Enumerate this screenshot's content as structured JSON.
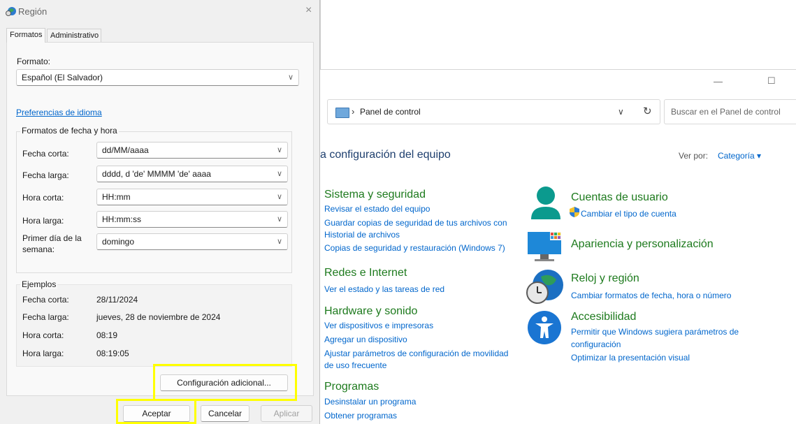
{
  "dialog": {
    "title": "Región",
    "close_glyph": "×",
    "tabs": [
      {
        "label": "Formatos"
      },
      {
        "label": "Administrativo"
      }
    ],
    "format_label": "Formato:",
    "format_value": "Español (El Salvador)",
    "lang_prefs_link": "Preferencias de idioma",
    "date_time_group": {
      "title": "Formatos de fecha y hora",
      "rows": [
        {
          "label": "Fecha corta:",
          "value": "dd/MM/aaaa"
        },
        {
          "label": "Fecha larga:",
          "value": "dddd, d 'de' MMMM 'de' aaaa"
        },
        {
          "label": "Hora corta:",
          "value": "HH:mm"
        },
        {
          "label": "Hora larga:",
          "value": "HH:mm:ss"
        }
      ],
      "first_day_label_1": "Primer día de la",
      "first_day_label_2": "semana:",
      "first_day_value": "domingo"
    },
    "examples": {
      "title": "Ejemplos",
      "rows": [
        {
          "label": "Fecha corta:",
          "value": "28/11/2024"
        },
        {
          "label": "Fecha larga:",
          "value": "jueves, 28 de noviembre de 2024"
        },
        {
          "label": "Hora corta:",
          "value": "08:19"
        },
        {
          "label": "Hora larga:",
          "value": "08:19:05"
        }
      ]
    },
    "additional_settings_button": "Configuración adicional...",
    "ok_button": "Aceptar",
    "cancel_button": "Cancelar",
    "apply_button": "Aplicar",
    "highlight_color": "#ffff00"
  },
  "control_panel": {
    "window_buttons": {
      "minimize": "—",
      "maximize": "☐"
    },
    "address": {
      "crumb_sep": "›",
      "crumb": "Panel de control",
      "dropdown": "∨",
      "refresh": "↻"
    },
    "search_placeholder": "Buscar en el Panel de control",
    "heading": "a configuración del equipo",
    "view_by_label": "Ver por:",
    "view_by_value": "Categoría",
    "categories_left": [
      {
        "title": "Sistema y seguridad",
        "links": [
          "Revisar el estado del equipo",
          "Guardar copias de seguridad de tus archivos con",
          "Historial de archivos",
          "Copias de seguridad y restauración (Windows 7)"
        ]
      },
      {
        "title": "Redes e Internet",
        "links": [
          "Ver el estado y las tareas de red"
        ]
      },
      {
        "title": "Hardware y sonido",
        "links": [
          "Ver dispositivos e impresoras",
          "Agregar un dispositivo",
          "Ajustar parámetros de configuración de movilidad",
          "de uso frecuente"
        ]
      },
      {
        "title": "Programas",
        "links": [
          "Desinstalar un programa",
          "Obtener programas"
        ]
      }
    ],
    "categories_right": [
      {
        "title": "Cuentas de usuario",
        "icon": "user-icon",
        "links": [
          "Cambiar el tipo de cuenta"
        ]
      },
      {
        "title": "Apariencia y personalización",
        "icon": "monitor-icon",
        "links": []
      },
      {
        "title": "Reloj y región",
        "icon": "clock-globe-icon",
        "links": [
          "Cambiar formatos de fecha, hora o número"
        ]
      },
      {
        "title": "Accesibilidad",
        "icon": "accessibility-icon",
        "links": [
          "Permitir que Windows sugiera parámetros de",
          "configuración",
          "Optimizar la presentación visual"
        ]
      }
    ]
  }
}
